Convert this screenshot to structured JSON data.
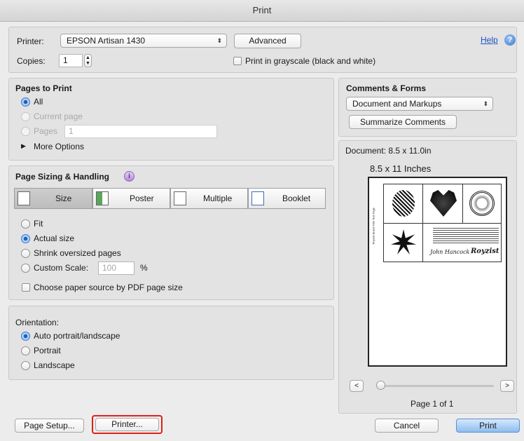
{
  "window": {
    "title": "Print"
  },
  "header": {
    "printer_label": "Printer:",
    "printer_value": "EPSON Artisan 1430",
    "advanced_label": "Advanced",
    "help_label": "Help",
    "copies_label": "Copies:",
    "copies_value": "1",
    "grayscale_label": "Print in grayscale (black and white)",
    "grayscale_checked": false
  },
  "pages_to_print": {
    "title": "Pages to Print",
    "options": [
      {
        "label": "All",
        "selected": true,
        "enabled": true
      },
      {
        "label": "Current page",
        "selected": false,
        "enabled": false
      },
      {
        "label": "Pages",
        "selected": false,
        "enabled": false
      }
    ],
    "pages_value": "1",
    "more_options_label": "More Options"
  },
  "sizing": {
    "title": "Page Sizing & Handling",
    "tabs": [
      {
        "label": "Size",
        "selected": true
      },
      {
        "label": "Poster",
        "selected": false
      },
      {
        "label": "Multiple",
        "selected": false
      },
      {
        "label": "Booklet",
        "selected": false
      }
    ],
    "options": [
      {
        "label": "Fit",
        "selected": false
      },
      {
        "label": "Actual size",
        "selected": true
      },
      {
        "label": "Shrink oversized pages",
        "selected": false
      },
      {
        "label": "Custom Scale:",
        "selected": false
      }
    ],
    "custom_scale_value": "100",
    "percent_label": "%",
    "paper_source_label": "Choose paper source by PDF page size"
  },
  "orientation": {
    "title": "Orientation:",
    "options": [
      {
        "label": "Auto portrait/landscape",
        "selected": true
      },
      {
        "label": "Portrait",
        "selected": false
      },
      {
        "label": "Landscape",
        "selected": false
      }
    ]
  },
  "comments_forms": {
    "title": "Comments & Forms",
    "select_value": "Document and Markups",
    "summarize_label": "Summarize Comments"
  },
  "preview": {
    "document_size": "Document: 8.5 x 11.0in",
    "paper_size": "8.5 x 11 Inches",
    "prev_label": "<",
    "next_label": ">",
    "page_status": "Page 1 of 1",
    "thumb_signature": "John Hancock",
    "thumb_logo": "Royzist",
    "thumb_side_text": "Royzist Brand Film Test Page"
  },
  "footer": {
    "page_setup_label": "Page Setup...",
    "printer_button_label": "Printer...",
    "cancel_label": "Cancel",
    "print_label": "Print",
    "highlight_color": "#e0201b"
  },
  "colors": {
    "accent": "#3a7bd5",
    "link": "#1a4fc2"
  }
}
